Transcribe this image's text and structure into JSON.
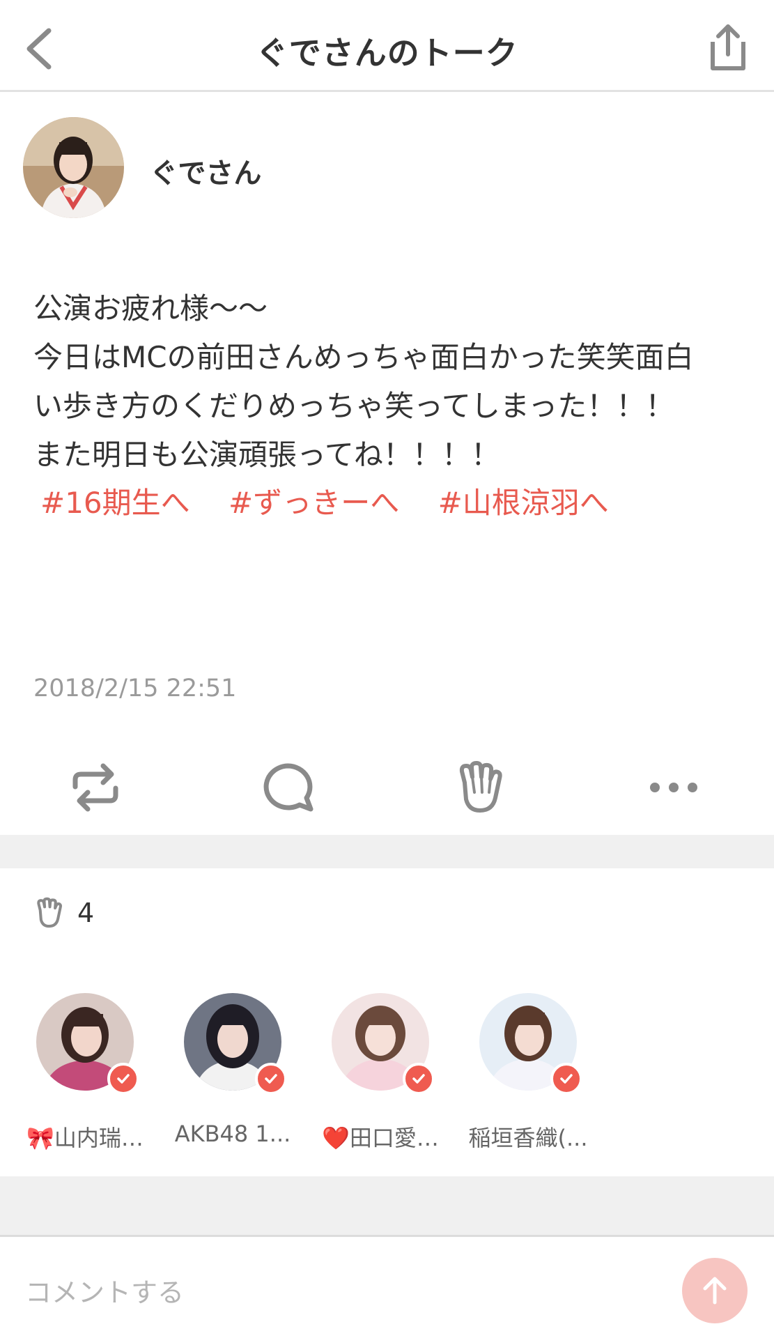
{
  "header": {
    "title": "ぐでさんのトーク"
  },
  "author": {
    "name": "ぐでさん"
  },
  "post": {
    "lines": [
      "公演お疲れ様〜〜",
      "今日はMCの前田さんめっちゃ面白かった笑笑面白",
      "い歩き方のくだりめっちゃ笑ってしまった！！！",
      "また明日も公演頑張ってね！！！！"
    ],
    "tags": [
      "#16期生へ",
      "#ずっきーへ",
      "#山根涼羽へ"
    ],
    "timestamp": "2018/2/15 22:51"
  },
  "actions": [
    {
      "icon": "repost-icon"
    },
    {
      "icon": "comment-icon"
    },
    {
      "icon": "clap-icon"
    },
    {
      "icon": "more-icon"
    }
  ],
  "likes": {
    "count": "4",
    "users": [
      {
        "name": "🎀山内瑞…"
      },
      {
        "name": "AKB48 1..."
      },
      {
        "name": "❤️田口愛…"
      },
      {
        "name": "稲垣香織(..."
      }
    ]
  },
  "comment": {
    "placeholder": "コメントする"
  },
  "colors": {
    "accent": "#e85a4f",
    "send_bg": "#f7c5c1",
    "badge": "#ef5b50"
  }
}
